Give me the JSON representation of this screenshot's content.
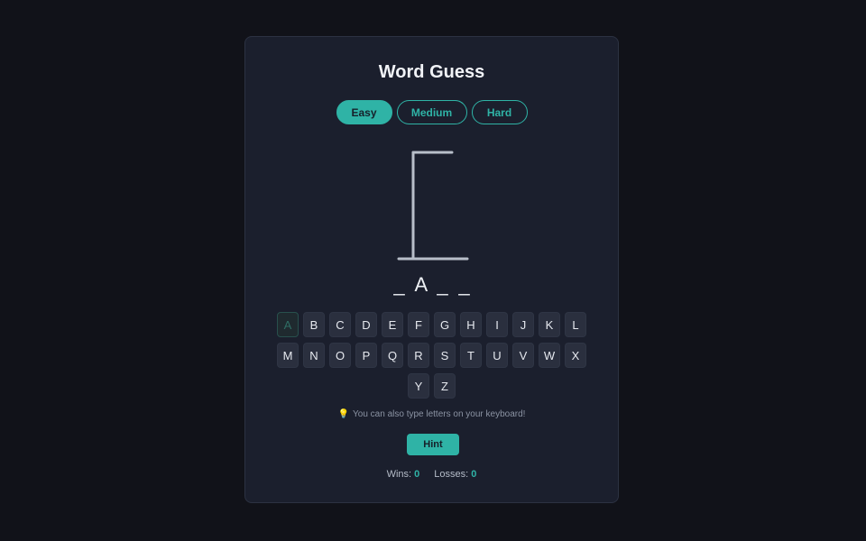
{
  "title": "Word Guess",
  "difficulty": {
    "options": [
      "Easy",
      "Medium",
      "Hard"
    ],
    "selected": "Easy"
  },
  "word_display": [
    "_",
    "A",
    "_",
    "_"
  ],
  "keyboard": {
    "rows": [
      [
        "A",
        "B",
        "C",
        "D",
        "E",
        "F",
        "G",
        "H",
        "I",
        "J",
        "K",
        "L"
      ],
      [
        "M",
        "N",
        "O",
        "P",
        "Q",
        "R",
        "S",
        "T",
        "U",
        "V",
        "W",
        "X"
      ],
      [
        "Y",
        "Z"
      ]
    ],
    "used": [
      "A"
    ]
  },
  "tip": {
    "icon": "lightbulb-icon",
    "glyph": "💡",
    "text": "You can also type letters on your keyboard!"
  },
  "hint_label": "Hint",
  "stats": {
    "wins_label": "Wins:",
    "wins": "0",
    "losses_label": "Losses:",
    "losses": "0"
  },
  "colors": {
    "accent": "#2fb3a6",
    "background": "#111219",
    "card": "#1b1f2d",
    "gallows": "#b8bec9"
  }
}
